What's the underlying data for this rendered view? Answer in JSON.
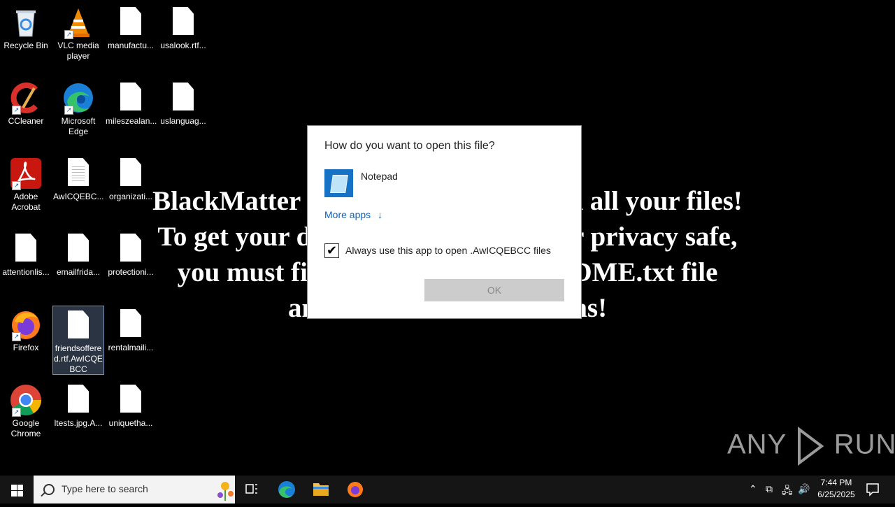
{
  "desktop": {
    "icons": [
      {
        "label": "Recycle Bin"
      },
      {
        "label": "VLC media player"
      },
      {
        "label": "manufactu..."
      },
      {
        "label": "usalook.rtf..."
      },
      {
        "label": "CCleaner"
      },
      {
        "label": "Microsoft Edge"
      },
      {
        "label": "mileszealan..."
      },
      {
        "label": "uslanguag..."
      },
      {
        "label": "Adobe Acrobat"
      },
      {
        "label": "AwICQEBC..."
      },
      {
        "label": "organizati..."
      },
      {
        "label": "attentionlis..."
      },
      {
        "label": "emailfrida..."
      },
      {
        "label": "protectioni..."
      },
      {
        "label": "Firefox"
      },
      {
        "label": "friendsoffered.rtf.AwICQEBCC"
      },
      {
        "label": "rentalmaili..."
      },
      {
        "label": "Google Chrome"
      },
      {
        "label": "ltests.jpg.A..."
      },
      {
        "label": "uniquetha..."
      }
    ],
    "ransom_note": [
      "BlackMatter Ransomware encrypted all your files!",
      "To get your data back and keep your privacy safe,",
      "you must find AwICQEBCC.README.txt file",
      "and follow the instructions!"
    ]
  },
  "dialog": {
    "title": "How do you want to open this file?",
    "app_name": "Notepad",
    "more_apps": "More apps",
    "more_apps_arrow": "↓",
    "always_use": "Always use this app to open .AwICQEBCC files",
    "always_use_checked": true,
    "ok_label": "OK"
  },
  "watermark": {
    "left": "ANY",
    "right": "RUN"
  },
  "taskbar": {
    "search_placeholder": "Type here to search",
    "clock_time": "7:44 PM",
    "clock_date": "6/25/2025"
  }
}
